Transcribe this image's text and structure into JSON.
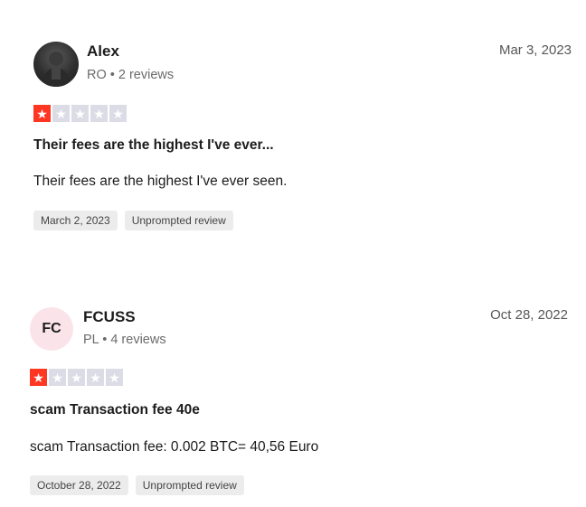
{
  "reviews": [
    {
      "name": "Alex",
      "avatar_initials": "",
      "meta": "RO • 2 reviews",
      "date": "Mar 3, 2023",
      "rating": 1,
      "title": "Their fees are the highest I've ever...",
      "body": "Their fees are the highest I've ever seen.",
      "tags": [
        "March 2, 2023",
        "Unprompted review"
      ]
    },
    {
      "name": "FCUSS",
      "avatar_initials": "FC",
      "meta": "PL • 4 reviews",
      "date": "Oct 28, 2022",
      "rating": 1,
      "title": "scam Transaction fee 40e",
      "body": "scam Transaction fee: 0.002 BTC= 40,56 Euro",
      "tags": [
        "October 28, 2022",
        "Unprompted review"
      ]
    }
  ],
  "colors": {
    "star_on": "#ff3722",
    "star_off": "#dcdce6",
    "initials_bg": "#fbe3ea",
    "tag_bg": "#ececec"
  },
  "icons": {
    "star": "star-icon",
    "avatar_photo": "user-photo"
  }
}
